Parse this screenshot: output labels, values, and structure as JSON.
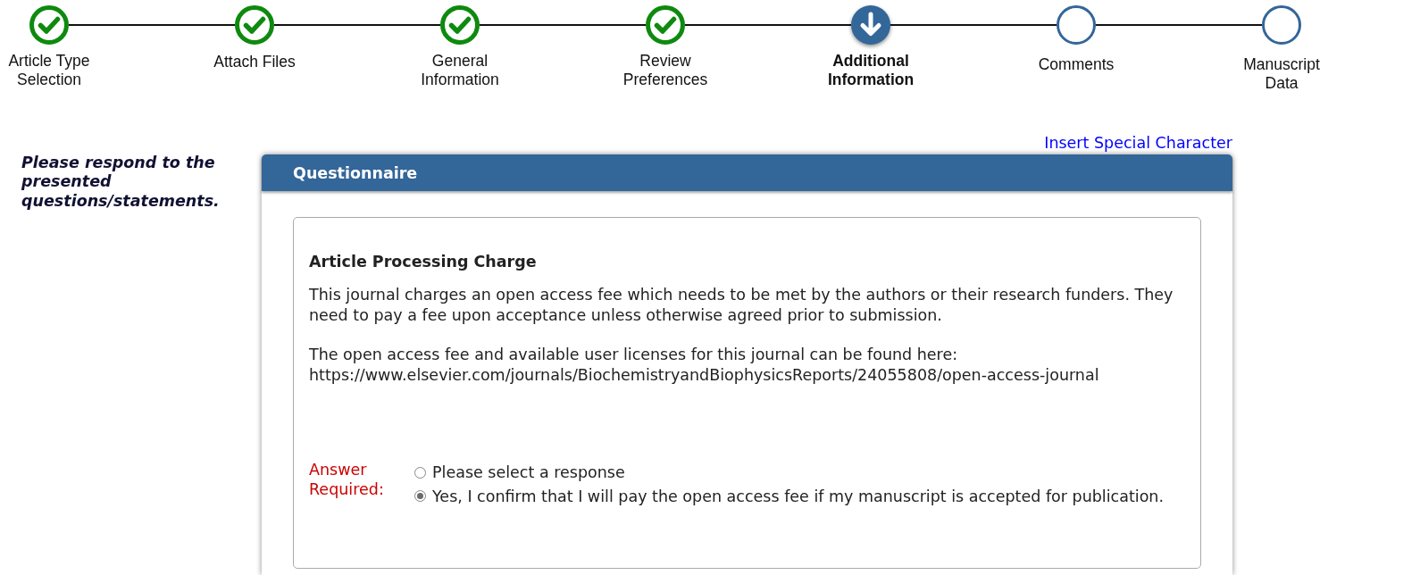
{
  "progress_steps": [
    {
      "label": "Article Type Selection",
      "completed": true,
      "current": false
    },
    {
      "label": "Attach Files",
      "completed": true,
      "current": false
    },
    {
      "label": "General Information",
      "completed": true,
      "current": false
    },
    {
      "label": "Review Preferences",
      "completed": true,
      "current": false
    },
    {
      "label": "Additional Information",
      "completed": false,
      "current": true
    },
    {
      "label": "Comments",
      "completed": false,
      "current": false
    },
    {
      "label": "Manuscript Data",
      "completed": false,
      "current": false
    }
  ],
  "instructions": "Please respond to the presented questions/statements.",
  "insert_special_character_link": "Insert Special Character",
  "questionnaire": {
    "title": "Questionnaire",
    "question": {
      "heading": "Article Processing Charge",
      "paragraphs": [
        "This journal charges an open access fee which needs to be met by the authors or their research funders. They need to pay a fee upon acceptance unless otherwise agreed prior to submission.",
        "The open access fee and available user licenses for this journal can be found here:"
      ],
      "url": "https://www.elsevier.com/journals/BiochemistryandBiophysicsReports/24055808/open-access-journal",
      "answer_label": "Answer Required:",
      "options": [
        {
          "label": "Please select a response",
          "selected": false
        },
        {
          "label": "Yes, I confirm that I will pay the open access fee if my manuscript is accepted for publication.",
          "selected": true
        }
      ]
    }
  }
}
